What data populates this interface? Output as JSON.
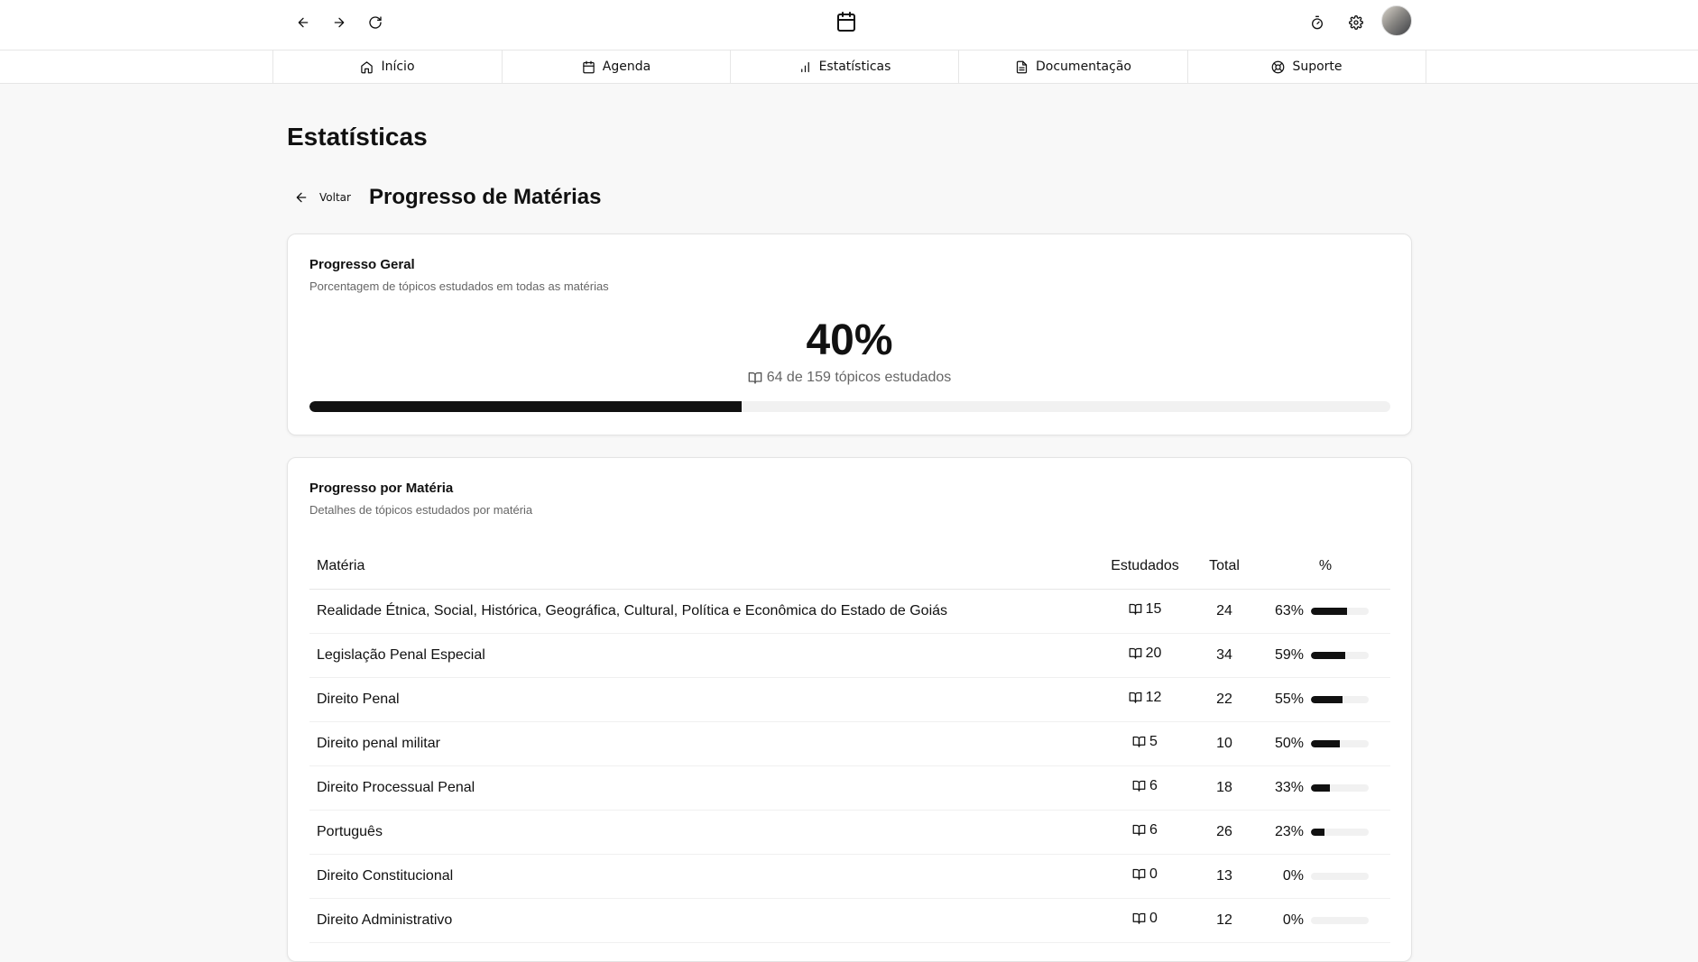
{
  "toolbar": {
    "back_icon": "arrow-left-icon",
    "forward_icon": "arrow-right-icon",
    "refresh_icon": "refresh-icon",
    "logo_icon": "calendar-icon",
    "timer_icon": "timer-icon",
    "settings_icon": "gear-icon"
  },
  "nav": {
    "tabs": [
      {
        "label": "Início",
        "icon": "home-icon"
      },
      {
        "label": "Agenda",
        "icon": "calendar-icon"
      },
      {
        "label": "Estatísticas",
        "icon": "bar-chart-icon"
      },
      {
        "label": "Documentação",
        "icon": "document-icon"
      },
      {
        "label": "Suporte",
        "icon": "lifebuoy-icon"
      }
    ]
  },
  "page": {
    "title": "Estatísticas",
    "back_label": "Voltar",
    "subtitle": "Progresso de Matérias"
  },
  "overall": {
    "title": "Progresso Geral",
    "description": "Porcentagem de tópicos estudados em todas as matérias",
    "percent_label": "40%",
    "percent": 40,
    "studied_text": "64 de 159 tópicos estudados"
  },
  "subjects": {
    "title": "Progresso por Matéria",
    "description": "Detalhes de tópicos estudados por matéria",
    "headers": {
      "subject": "Matéria",
      "studied": "Estudados",
      "total": "Total",
      "percent": "%"
    },
    "rows": [
      {
        "name": "Realidade Étnica, Social, Histórica, Geográfica, Cultural, Política e Econômica do Estado de Goiás",
        "studied": "15",
        "total": "24",
        "pct_label": "63%",
        "pct": 63
      },
      {
        "name": "Legislação Penal Especial",
        "studied": "20",
        "total": "34",
        "pct_label": "59%",
        "pct": 59
      },
      {
        "name": "Direito Penal",
        "studied": "12",
        "total": "22",
        "pct_label": "55%",
        "pct": 55
      },
      {
        "name": "Direito penal militar",
        "studied": "5",
        "total": "10",
        "pct_label": "50%",
        "pct": 50
      },
      {
        "name": "Direito Processual Penal",
        "studied": "6",
        "total": "18",
        "pct_label": "33%",
        "pct": 33
      },
      {
        "name": "Português",
        "studied": "6",
        "total": "26",
        "pct_label": "23%",
        "pct": 23
      },
      {
        "name": "Direito Constitucional",
        "studied": "0",
        "total": "13",
        "pct_label": "0%",
        "pct": 0
      },
      {
        "name": "Direito Administrativo",
        "studied": "0",
        "total": "12",
        "pct_label": "0%",
        "pct": 0
      }
    ]
  }
}
